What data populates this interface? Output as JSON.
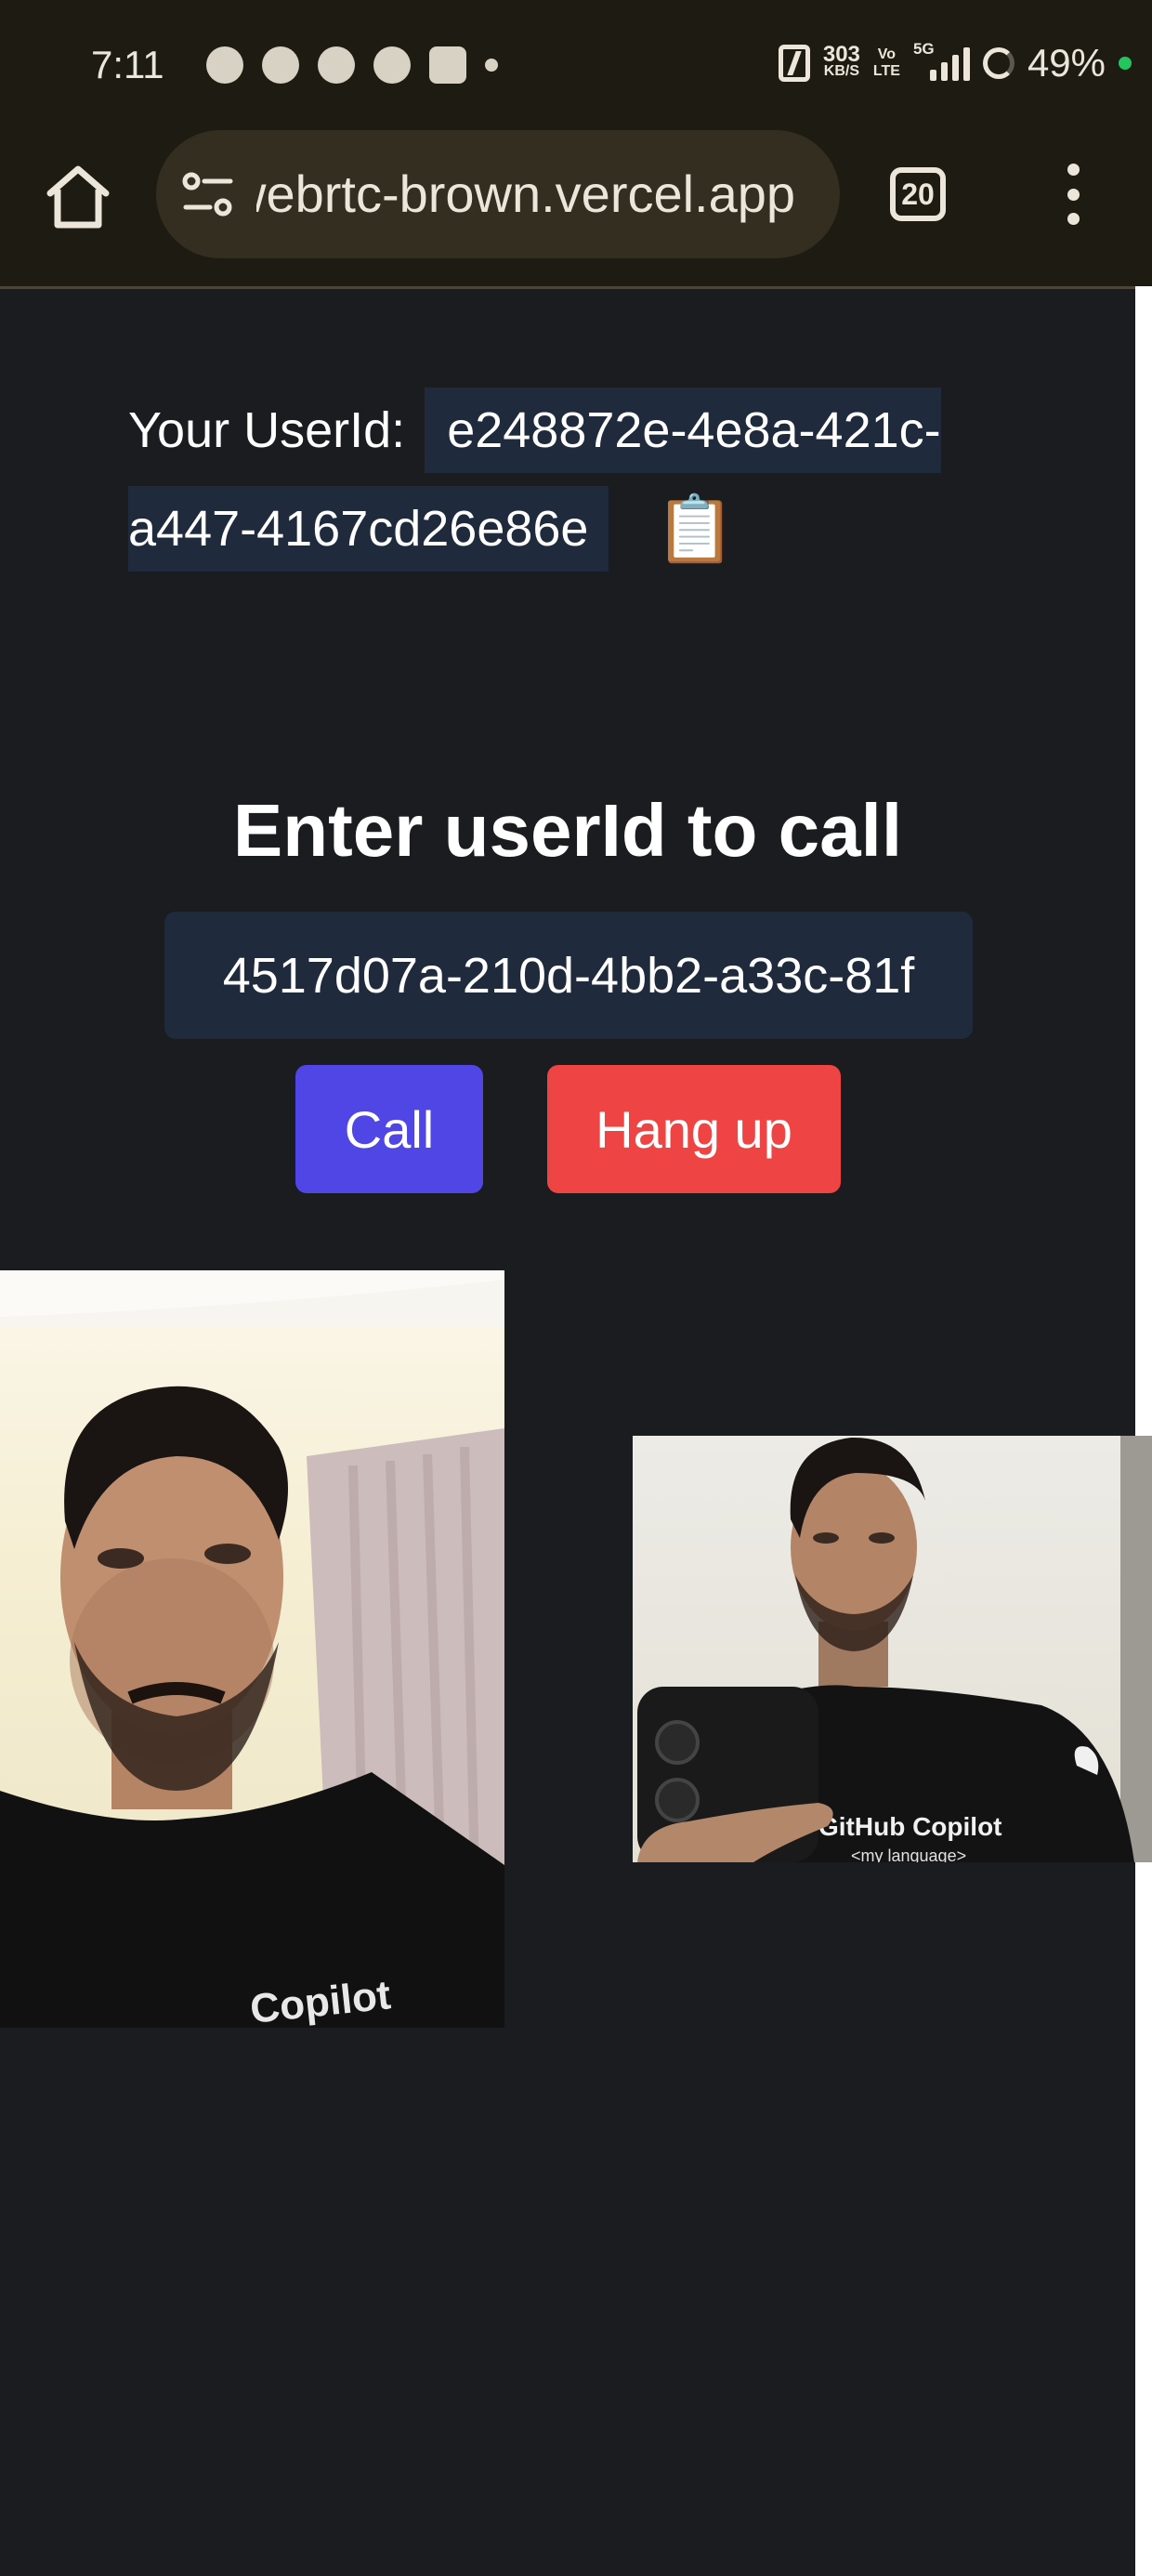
{
  "status_bar": {
    "time": "7:11",
    "net_speed_value": "303",
    "net_speed_unit": "KB/S",
    "volte_top": "Vo",
    "volte_bottom": "LTE",
    "network_type": "5G",
    "battery": "49%",
    "icons": [
      "chat-bubble-icon",
      "discord-icon",
      "whatsapp-icon",
      "app-icon",
      "app-icon",
      "more-dot-icon"
    ]
  },
  "browser": {
    "url": "webrtc-brown.vercel.app",
    "tab_count": "20"
  },
  "page": {
    "userid_label": "Your UserId:",
    "userid_value": "e248872e-4e8a-421c-a447-4167cd26e86e",
    "copy_icon": "📋",
    "heading": "Enter userId to call",
    "callee_input_value": "4517d07a-210d-4bb2-a33c-81f",
    "call_button": "Call",
    "hangup_button": "Hang up",
    "remote_shirt_text": "Copilot",
    "local_shirt_text": "GitHub Copilot",
    "local_shirt_subtext": "<my language>"
  },
  "colors": {
    "page_background": "#1b1c1f",
    "chrome_background": "#1e1b12",
    "input_background": "#1f2a3c",
    "call_button": "#4f46e5",
    "hangup_button": "#ef4444"
  }
}
